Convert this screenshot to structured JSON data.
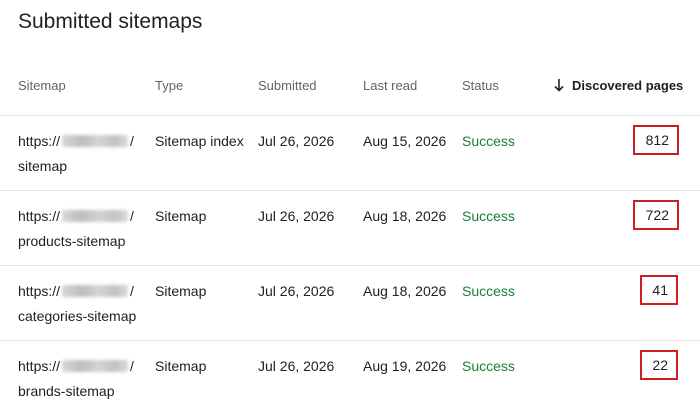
{
  "page": {
    "title": "Submitted sitemaps"
  },
  "table": {
    "headers": {
      "sitemap": "Sitemap",
      "type": "Type",
      "submitted": "Submitted",
      "last_read": "Last read",
      "status": "Status",
      "discovered_pages": "Discovered pages"
    },
    "sort_icon": "arrow-down-icon",
    "rows": [
      {
        "url_prefix": "https://",
        "url_suffix": "/",
        "url_path": "sitemap",
        "type": "Sitemap index",
        "submitted": "Jul 26, 2026",
        "last_read": "Aug 15, 2026",
        "status": "Success",
        "discovered_pages": "812"
      },
      {
        "url_prefix": "https://",
        "url_suffix": "/",
        "url_path": "products-sitemap",
        "type": "Sitemap",
        "submitted": "Jul 26, 2026",
        "last_read": "Aug 18, 2026",
        "status": "Success",
        "discovered_pages": "722"
      },
      {
        "url_prefix": "https://",
        "url_suffix": "/",
        "url_path": "categories-sitemap",
        "type": "Sitemap",
        "submitted": "Jul 26, 2026",
        "last_read": "Aug 18, 2026",
        "status": "Success",
        "discovered_pages": "41"
      },
      {
        "url_prefix": "https://",
        "url_suffix": "/",
        "url_path": "brands-sitemap",
        "type": "Sitemap",
        "submitted": "Jul 26, 2026",
        "last_read": "Aug 19, 2026",
        "status": "Success",
        "discovered_pages": "22"
      }
    ]
  },
  "colors": {
    "status_success": "#188038",
    "highlight_box": "#cc1f1f",
    "divider": "#e0e0e0"
  }
}
